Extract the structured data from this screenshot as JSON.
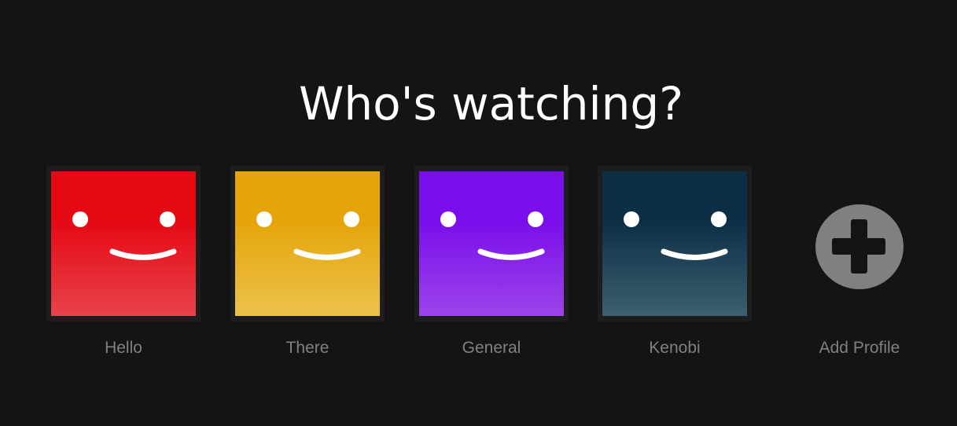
{
  "page": {
    "title": "Who's watching?"
  },
  "profiles": [
    {
      "name": "Hello",
      "avatar_top": "#e50914",
      "avatar_bottom": "#e8434c",
      "avatar_icon": "smiley-face-icon"
    },
    {
      "name": "There",
      "avatar_top": "#e5a50a",
      "avatar_bottom": "#ecc24c",
      "avatar_icon": "smiley-face-icon"
    },
    {
      "name": "General",
      "avatar_top": "#7a0eea",
      "avatar_bottom": "#9c44ea",
      "avatar_icon": "smiley-face-icon"
    },
    {
      "name": "Kenobi",
      "avatar_top": "#0d2f45",
      "avatar_bottom": "#3e5f70",
      "avatar_icon": "smiley-face-icon"
    }
  ],
  "add_profile": {
    "label": "Add Profile",
    "icon": "plus-circle-icon",
    "circle_color": "#808080",
    "plus_color": "#141414"
  },
  "colors": {
    "background": "#141414",
    "title_text": "#ffffff",
    "name_text": "#808080"
  }
}
